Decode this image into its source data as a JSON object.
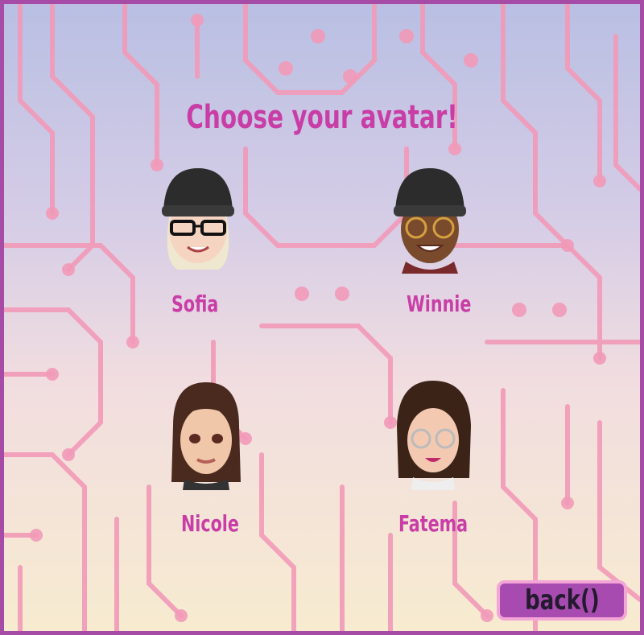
{
  "title": "Choose your avatar!",
  "avatars": [
    {
      "name": "Sofia",
      "skin": "#f6d4c2",
      "hair": "#efe7cf",
      "hat": "#2c2c2c",
      "glasses": true
    },
    {
      "name": "Winnie",
      "skin": "#7a4a2d",
      "hair": "#2a1a12",
      "hat": "#2c2c2c",
      "glasses": true
    },
    {
      "name": "Nicole",
      "skin": "#f0c7a8",
      "hair": "#4a2a1e",
      "hat": null,
      "glasses": false
    },
    {
      "name": "Fatema",
      "skin": "#f3c9b2",
      "hair": "#3b2417",
      "hat": null,
      "glasses": true
    }
  ],
  "back_label": "back()",
  "colors": {
    "border": "#a64ca6",
    "accent": "#c93ea6",
    "circuit": "#f29ab8",
    "button": "#a84bb0"
  }
}
